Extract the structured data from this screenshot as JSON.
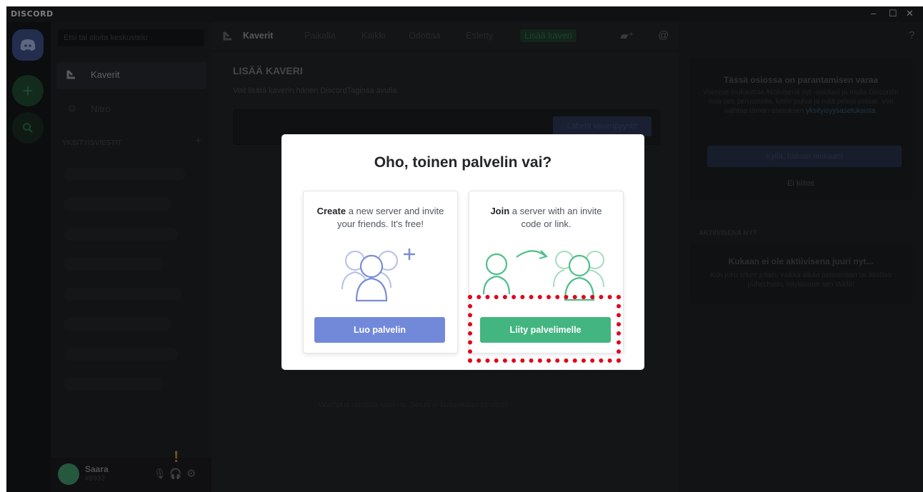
{
  "app": {
    "title": "DISCORD"
  },
  "window_controls": {
    "minimize": "–",
    "maximize": "☐",
    "close": "✕"
  },
  "sidebar": {
    "search_placeholder": "Etsi tai aloita keskustelu",
    "friends_label": "Kaverit",
    "nitro_label": "Nitro",
    "dm_header": "YKSITYISVIESTIT",
    "dm_add": "+"
  },
  "user": {
    "name": "Saara",
    "tag": "#8932"
  },
  "header": {
    "tabs": [
      "Kaverit",
      "Paikalla",
      "Kaikki",
      "Odottaa",
      "Estetty",
      "Lisää kaveri"
    ]
  },
  "add_friend": {
    "title": "LISÄÄ KAVERI",
    "subtitle": "Voit lisätä kaverin hänen DiscordTaginsa avulla.",
    "button": "Lähetä kaveripyyntö"
  },
  "empty_state": "Wumpus odottaa kaveria. Sinun ei kuitenkaan tarvitse!",
  "right_panel": {
    "promo_title": "Tässä osiossa on parantamisen varaa",
    "promo_text": "Voimme mukauttaa Aktiivisena nyt -osiotasi ja muita Discordin osia sen perusteella, keille puhut ja mitä pelejä pelaat. Voit vaihtaa tämän asetuksen",
    "promo_link": "yksityisyysasetuksista.",
    "promo_yes": "Kyllä, haluan mukaan!",
    "promo_no": "Ei kiitos",
    "active_header": "AKTIIVISENA NYT",
    "active_title": "Kukaan ei ole aktiivisena juuri nyt...",
    "active_text": "Kun joku tekee jotain, vaikka alkaa pelaamaan tai aloittaa puhechatin, näytämme sen täällä!"
  },
  "modal": {
    "title": "Oho, toinen palvelin vai?",
    "create": {
      "bold": "Create",
      "text": " a new server and invite your friends. It's free!",
      "button": "Luo palvelin"
    },
    "join": {
      "bold": "Join",
      "text": " a server with an invite code or link.",
      "button": "Liity palvelimelle"
    }
  },
  "colors": {
    "create_button": "#7289da",
    "join_button": "#43b581",
    "highlight": "#e3001b"
  },
  "icons": [
    "discord-logo-icon",
    "add-server-icon",
    "search-servers-icon",
    "friends-icon",
    "nitro-icon",
    "mic-icon",
    "headphones-icon",
    "settings-icon",
    "new-group-dm-icon",
    "mention-icon",
    "help-icon",
    "create-server-illustration-icon",
    "join-server-illustration-icon"
  ]
}
